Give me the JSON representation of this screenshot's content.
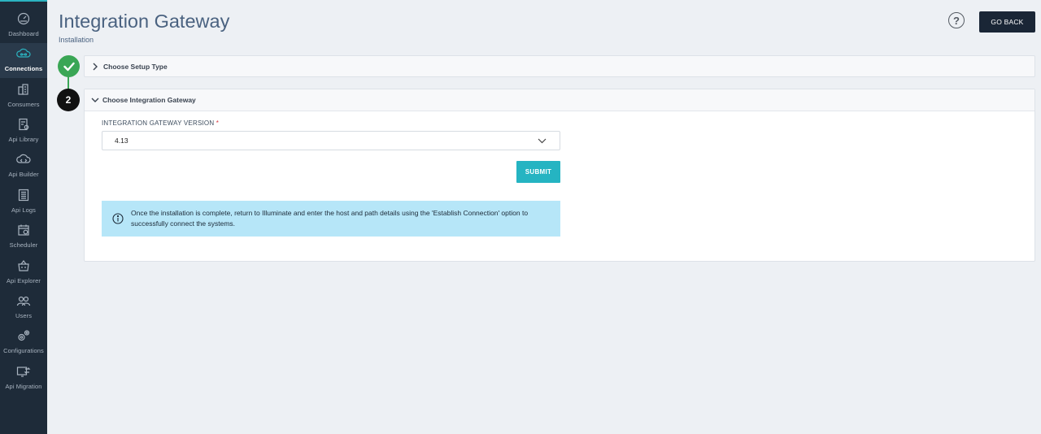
{
  "sidebar": {
    "items": [
      {
        "label": "Dashboard",
        "icon": "dashboard-icon",
        "active": false
      },
      {
        "label": "Connections",
        "icon": "connections-icon",
        "active": true
      },
      {
        "label": "Consumers",
        "icon": "consumers-icon",
        "active": false
      },
      {
        "label": "Api Library",
        "icon": "api-library-icon",
        "active": false
      },
      {
        "label": "Api Builder",
        "icon": "api-builder-icon",
        "active": false
      },
      {
        "label": "Api Logs",
        "icon": "api-logs-icon",
        "active": false
      },
      {
        "label": "Scheduler",
        "icon": "scheduler-icon",
        "active": false
      },
      {
        "label": "Api Explorer",
        "icon": "api-explorer-icon",
        "active": false
      },
      {
        "label": "Users",
        "icon": "users-icon",
        "active": false
      },
      {
        "label": "Configurations",
        "icon": "configurations-icon",
        "active": false
      },
      {
        "label": "Api Migration",
        "icon": "api-migration-icon",
        "active": false
      }
    ]
  },
  "header": {
    "title": "Integration Gateway",
    "subtitle": "Installation",
    "help_icon": "?",
    "go_back_label": "GO BACK"
  },
  "steps": [
    {
      "number": "1",
      "status": "completed",
      "title": "Choose Setup Type",
      "expanded": false
    },
    {
      "number": "2",
      "status": "active",
      "title": "Choose Integration Gateway",
      "expanded": true
    }
  ],
  "form": {
    "version_label": "INTEGRATION GATEWAY VERSION",
    "required_mark": "*",
    "version_value": "4.13",
    "submit_label": "SUBMIT"
  },
  "info": {
    "message": "Once the installation is complete, return to Illuminate and enter the host and path details using the 'Establish Connection' option to successfully connect the systems."
  },
  "colors": {
    "sidebar_bg": "#1e2b39",
    "accent": "#25b4c2",
    "success": "#3aa655",
    "info_bg": "#b6e6f8",
    "dark_button": "#1a2636"
  }
}
